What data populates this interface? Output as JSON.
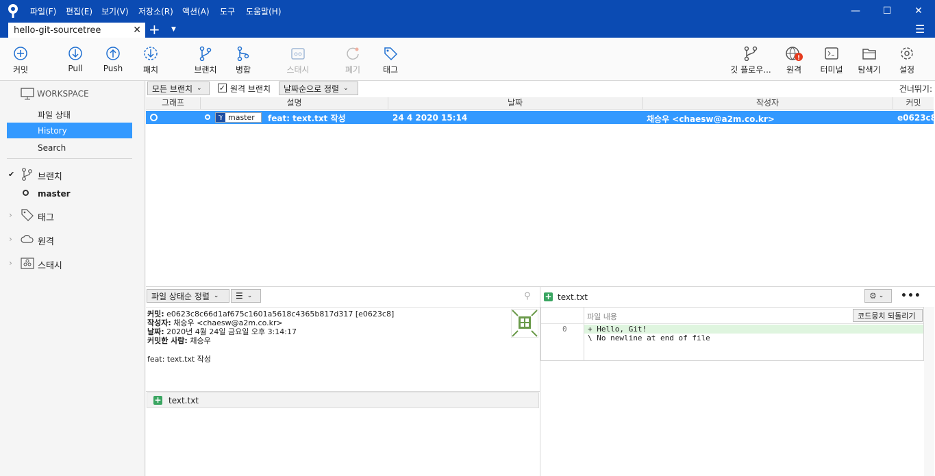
{
  "menu": [
    "파일(F)",
    "편집(E)",
    "보기(V)",
    "저장소(R)",
    "액션(A)",
    "도구",
    "도움말(H)"
  ],
  "tab": {
    "title": "hello-git-sourcetree"
  },
  "toolbar": {
    "commit": "커밋",
    "pull": "Pull",
    "push": "Push",
    "patch": "패치",
    "branch": "브랜치",
    "merge": "병합",
    "stash": "스태시",
    "discard": "폐기",
    "tag": "태그",
    "gitflow": "깃 플로우...",
    "remote": "원격",
    "terminal": "터미널",
    "explorer": "탐색기",
    "settings": "설정"
  },
  "sidebar": {
    "workspace": "WORKSPACE",
    "items": [
      "파일 상태",
      "History",
      "Search"
    ],
    "branches": "브랜치",
    "branch_master": "master",
    "tags": "태그",
    "remotes": "원격",
    "stashes": "스태시"
  },
  "filters": {
    "branches": "모든 브랜치",
    "remote_checkbox": "원격 브랜치",
    "sort": "날짜순으로 정렬",
    "jump": "건너뛰기:"
  },
  "columns": {
    "graph": "그래프",
    "desc": "설명",
    "date": "날짜",
    "author": "작성자",
    "commit": "커밋"
  },
  "commit_row": {
    "branch_label": "master",
    "desc": "feat: text.txt 작성",
    "date": "24 4 2020 15:14",
    "author": "채승우 <chaesw@a2m.co.kr>",
    "hash": "e0623c8"
  },
  "details": {
    "sort": "파일 상태순 정렬",
    "commit_key": "커밋:",
    "commit_val": " e0623c8c66d1af675c1601a5618c4365b817d317 [e0623c8]",
    "author_key": "작성자:",
    "author_val": " 채승우 <chaesw@a2m.co.kr>",
    "date_key": "날짜:",
    "date_val": " 2020년 4월 24일 금요일 오후 3:14:17",
    "committer_key": "커밋한 사람:",
    "committer_val": " 채승우",
    "message": "feat: text.txt 작성",
    "file": "text.txt"
  },
  "diff": {
    "file": "text.txt",
    "header": "파일 내용",
    "revert": "코드뭉치 되돌리기",
    "line_no": "0",
    "line1": "+ Hello, Git!",
    "line2": "\\ No newline at end of file"
  },
  "colors": {
    "titlebar": "#0b4bb3",
    "selection": "#3399ff",
    "sidebar_selection": "#3399ff",
    "added": "#3aa561"
  }
}
